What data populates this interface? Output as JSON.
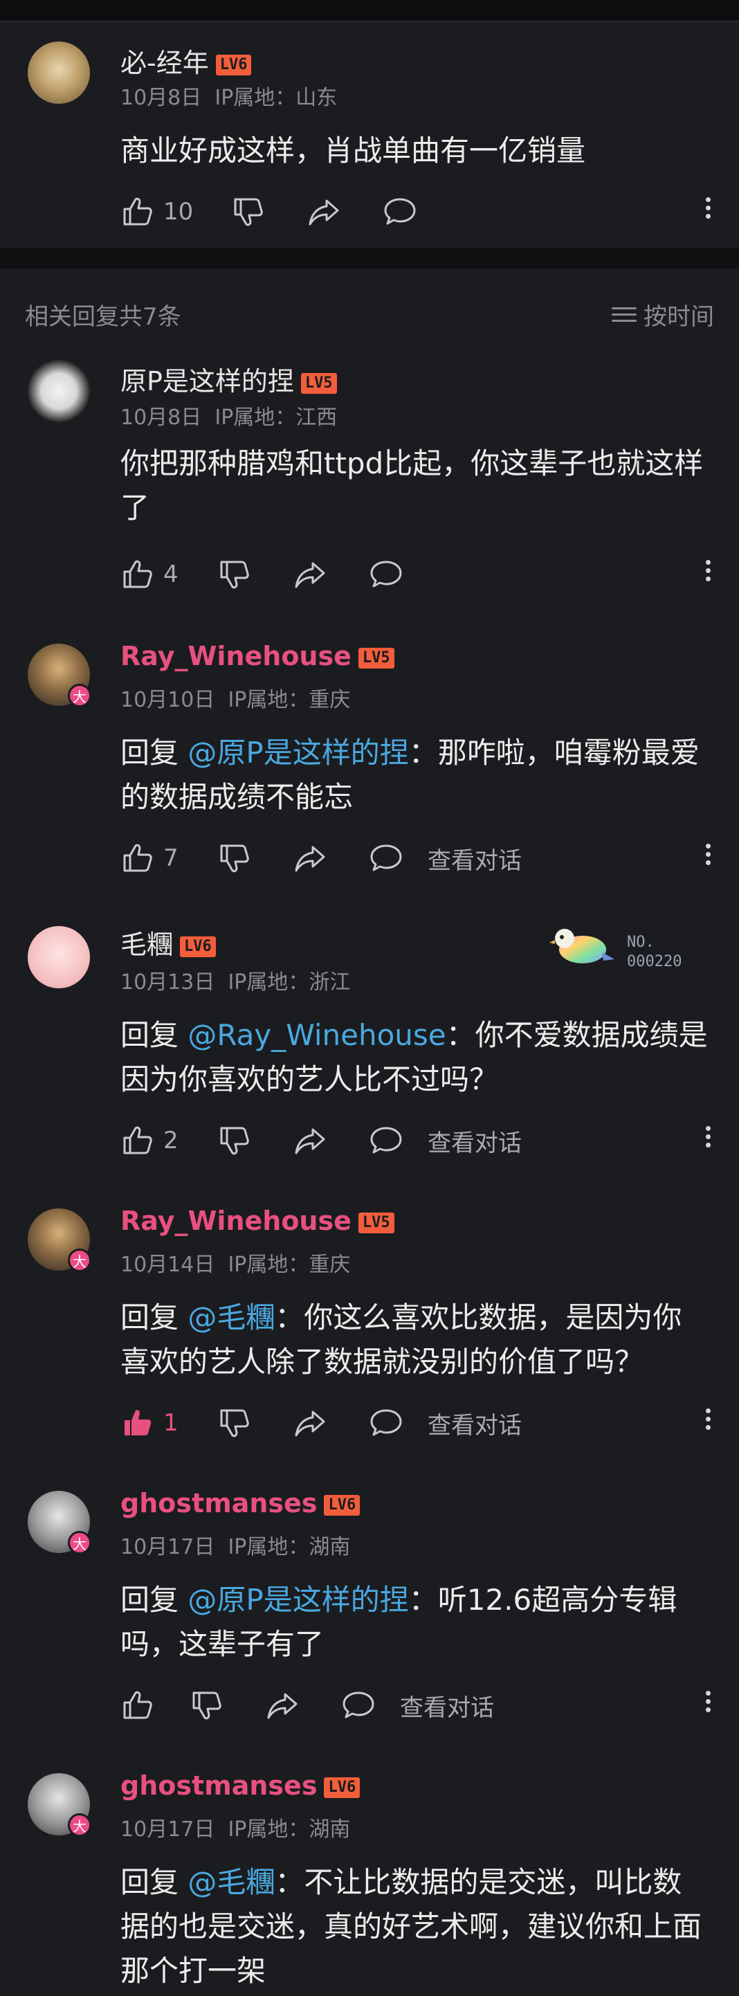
{
  "main_comment": {
    "username": "必-经年",
    "level": "LV6",
    "date": "10月8日",
    "ip_label": "IP属地：山东",
    "text": "商业好成这样，肖战单曲有一亿销量",
    "likes": "10"
  },
  "replies_header": {
    "title": "相关回复共7条",
    "sort_label": "按时间"
  },
  "replies": [
    {
      "username": "原P是这样的捏",
      "level": "LV5",
      "date": "10月8日",
      "ip_label": "IP属地：江西",
      "text": "你把那种腊鸡和ttpd比起，你这辈子也就这样了",
      "likes": "4"
    },
    {
      "username": "Ray_Winehouse",
      "level": "LV5",
      "date": "10月10日",
      "ip_label": "IP属地：重庆",
      "reply_prefix": "回复",
      "mention": "@原P是这样的捏",
      "text": "：那咋啦，咱霉粉最爱的数据成绩不能忘",
      "likes": "7",
      "view_convo": "查看对话"
    },
    {
      "username": "毛糰",
      "level": "LV6",
      "date": "10月13日",
      "ip_label": "IP属地：浙江",
      "reply_prefix": "回复",
      "mention": "@Ray_Winehouse",
      "text": "：你不爱数据成绩是因为你喜欢的艺人比不过吗？",
      "likes": "2",
      "view_convo": "查看对话",
      "medal_no": "NO.",
      "medal_num": "000220"
    },
    {
      "username": "Ray_Winehouse",
      "level": "LV5",
      "date": "10月14日",
      "ip_label": "IP属地：重庆",
      "reply_prefix": "回复",
      "mention": "@毛糰",
      "text": "：你这么喜欢比数据，是因为你喜欢的艺人除了数据就没别的价值了吗？",
      "likes": "1",
      "liked": true,
      "view_convo": "查看对话"
    },
    {
      "username": "ghostmanses",
      "level": "LV6",
      "date": "10月17日",
      "ip_label": "IP属地：湖南",
      "reply_prefix": "回复",
      "mention": "@原P是这样的捏",
      "text": "：听12.6超高分专辑吗，这辈子有了",
      "likes": "",
      "view_convo": "查看对话"
    },
    {
      "username": "ghostmanses",
      "level": "LV6",
      "date": "10月17日",
      "ip_label": "IP属地：湖南",
      "reply_prefix": "回复",
      "mention": "@毛糰",
      "text": "：不让比数据的是交迷，叫比数据的也是交迷，真的好艺术啊，建议你和上面那个打一架"
    }
  ],
  "badge_da": "大",
  "colors": {
    "background": "#111214",
    "card": "#1b1c1f",
    "vip_name": "#e8507f",
    "mention": "#4aa8e0",
    "level_badge": "#f25d3b",
    "liked": "#e8507f"
  },
  "icons": [
    "thumb-up-icon",
    "thumb-down-icon",
    "share-icon",
    "comment-icon",
    "more-icon",
    "sort-icon"
  ]
}
